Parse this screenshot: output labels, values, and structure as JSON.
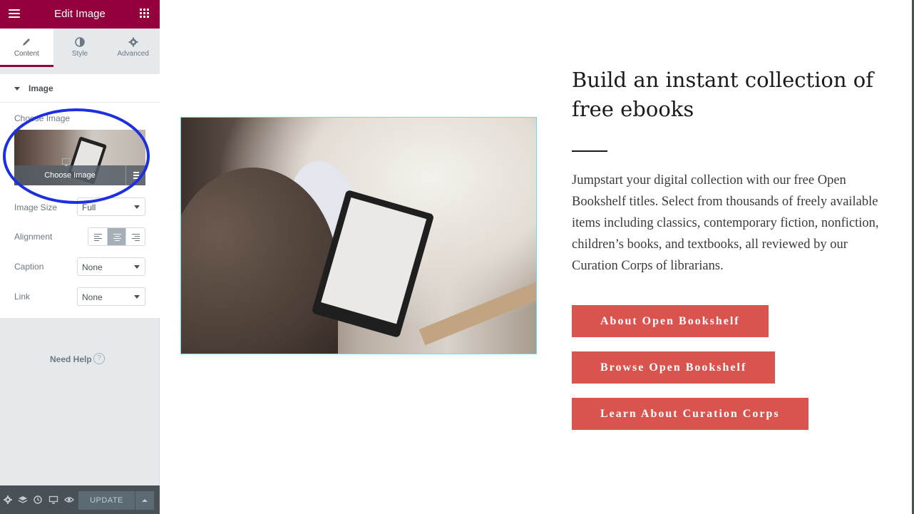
{
  "sidebar": {
    "title": "Edit Image",
    "tabs": [
      {
        "label": "Content",
        "icon": "pencil-icon",
        "active": true
      },
      {
        "label": "Style",
        "icon": "contrast-icon",
        "active": false
      },
      {
        "label": "Advanced",
        "icon": "gear-icon",
        "active": false
      }
    ],
    "section_title": "Image",
    "choose_image_label": "Choose Image",
    "choose_image_button": "Choose Image",
    "image_size_label": "Image Size",
    "image_size_value": "Full",
    "alignment_label": "Alignment",
    "alignment_selected": "center",
    "caption_label": "Caption",
    "caption_value": "None",
    "link_label": "Link",
    "link_value": "None",
    "need_help": "Need Help",
    "help_glyph": "?",
    "footer": {
      "update_label": "UPDATE",
      "icons": [
        "settings-icon",
        "navigator-icon",
        "history-icon",
        "responsive-icon",
        "preview-icon"
      ]
    },
    "collapse_glyph": "‹"
  },
  "canvas": {
    "heading": "Build an instant collection of free ebooks",
    "body": "Jumpstart your digital collection with our free Open Bookshelf titles. Select from thousands of freely available items including classics, contemporary fiction, nonfiction, children’s books, and textbooks, all reviewed by our Curation Corps of librarians.",
    "buttons": [
      {
        "label": "About Open Bookshelf"
      },
      {
        "label": "Browse Open Bookshelf"
      },
      {
        "label": "Learn About Curation Corps"
      }
    ]
  },
  "colors": {
    "brand": "#93003c",
    "button": "#d9534f",
    "annotation": "#1d2fe0",
    "selection_outline": "#71d7f7"
  }
}
